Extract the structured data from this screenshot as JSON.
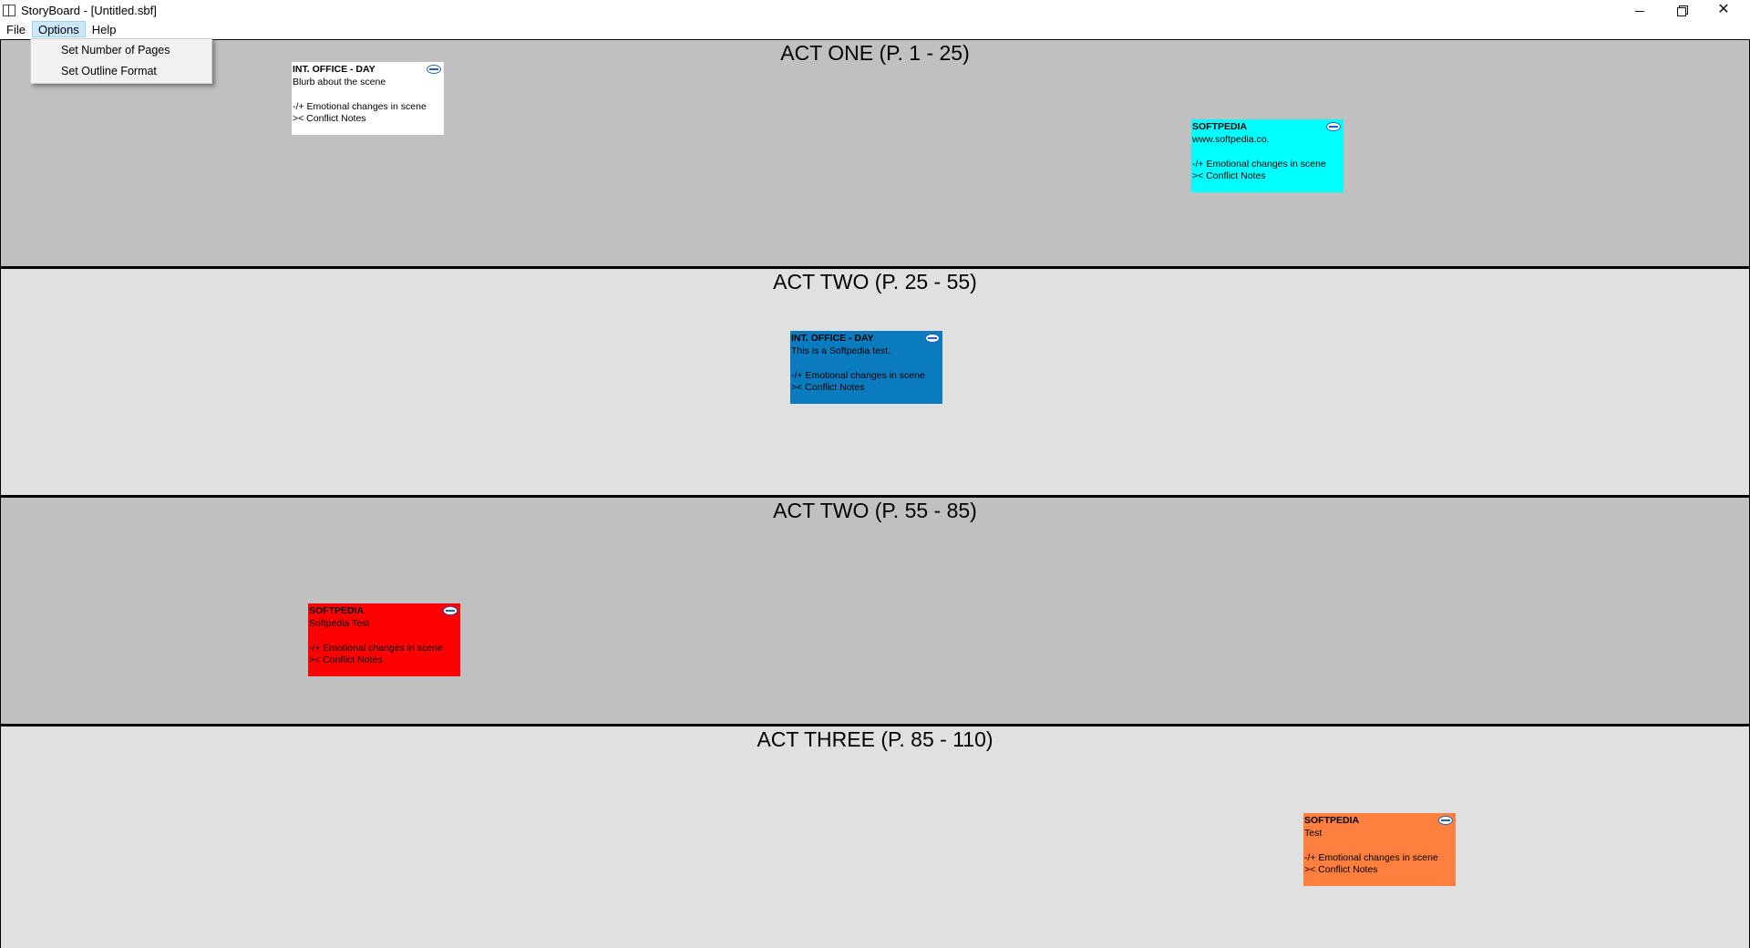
{
  "window": {
    "title": "StoryBoard - [Untitled.sbf]",
    "controls": {
      "minimize": "minimize",
      "maximize": "restore",
      "close": "✕"
    }
  },
  "menu": {
    "items": [
      {
        "label": "File"
      },
      {
        "label": "Options",
        "active": true
      },
      {
        "label": "Help"
      }
    ],
    "dropdown": [
      {
        "label": "Set Number of Pages"
      },
      {
        "label": "Set Outline Format"
      }
    ]
  },
  "acts": [
    {
      "title": "ACT ONE (P. 1 - 25)",
      "background": "#c0c0c0",
      "cards": [
        {
          "heading": "INT. OFFICE - DAY",
          "blurb": "Blurb about the scene",
          "emotion": "-/+ Emotional changes in scene",
          "conflict": ">< Conflict Notes",
          "color": "#ffffff",
          "text_color": "#000000"
        },
        {
          "heading": "SOFTPEDIA",
          "blurb": "www.softpedia.co.",
          "emotion": "-/+ Emotional changes in scene",
          "conflict": ">< Conflict Notes",
          "color": "#00ffff",
          "text_color": "#000000"
        }
      ]
    },
    {
      "title": "ACT TWO (P. 25 - 55)",
      "background": "#e0e0e0",
      "cards": [
        {
          "heading": "INT. OFFICE - DAY",
          "blurb": "This is a Softpedia test.",
          "emotion": "-/+ Emotional changes in scene",
          "conflict": ">< Conflict Notes",
          "color": "#0a7bbf",
          "text_color": "#000000"
        }
      ]
    },
    {
      "title": "ACT TWO (P. 55 - 85)",
      "background": "#c0c0c0",
      "cards": [
        {
          "heading": "SOFTPEDIA",
          "blurb": "Softpedia Test",
          "emotion": "-/+ Emotional changes in scene",
          "conflict": ">< Conflict Notes",
          "color": "#ff0000",
          "text_color": "#000000"
        }
      ]
    },
    {
      "title": "ACT THREE (P. 85 - 110)",
      "background": "#e0e0e0",
      "cards": [
        {
          "heading": "SOFTPEDIA",
          "blurb": "Test",
          "emotion": "-/+ Emotional changes in scene",
          "conflict": ">< Conflict Notes",
          "color": "#ff7f3f",
          "text_color": "#000000"
        }
      ]
    }
  ]
}
